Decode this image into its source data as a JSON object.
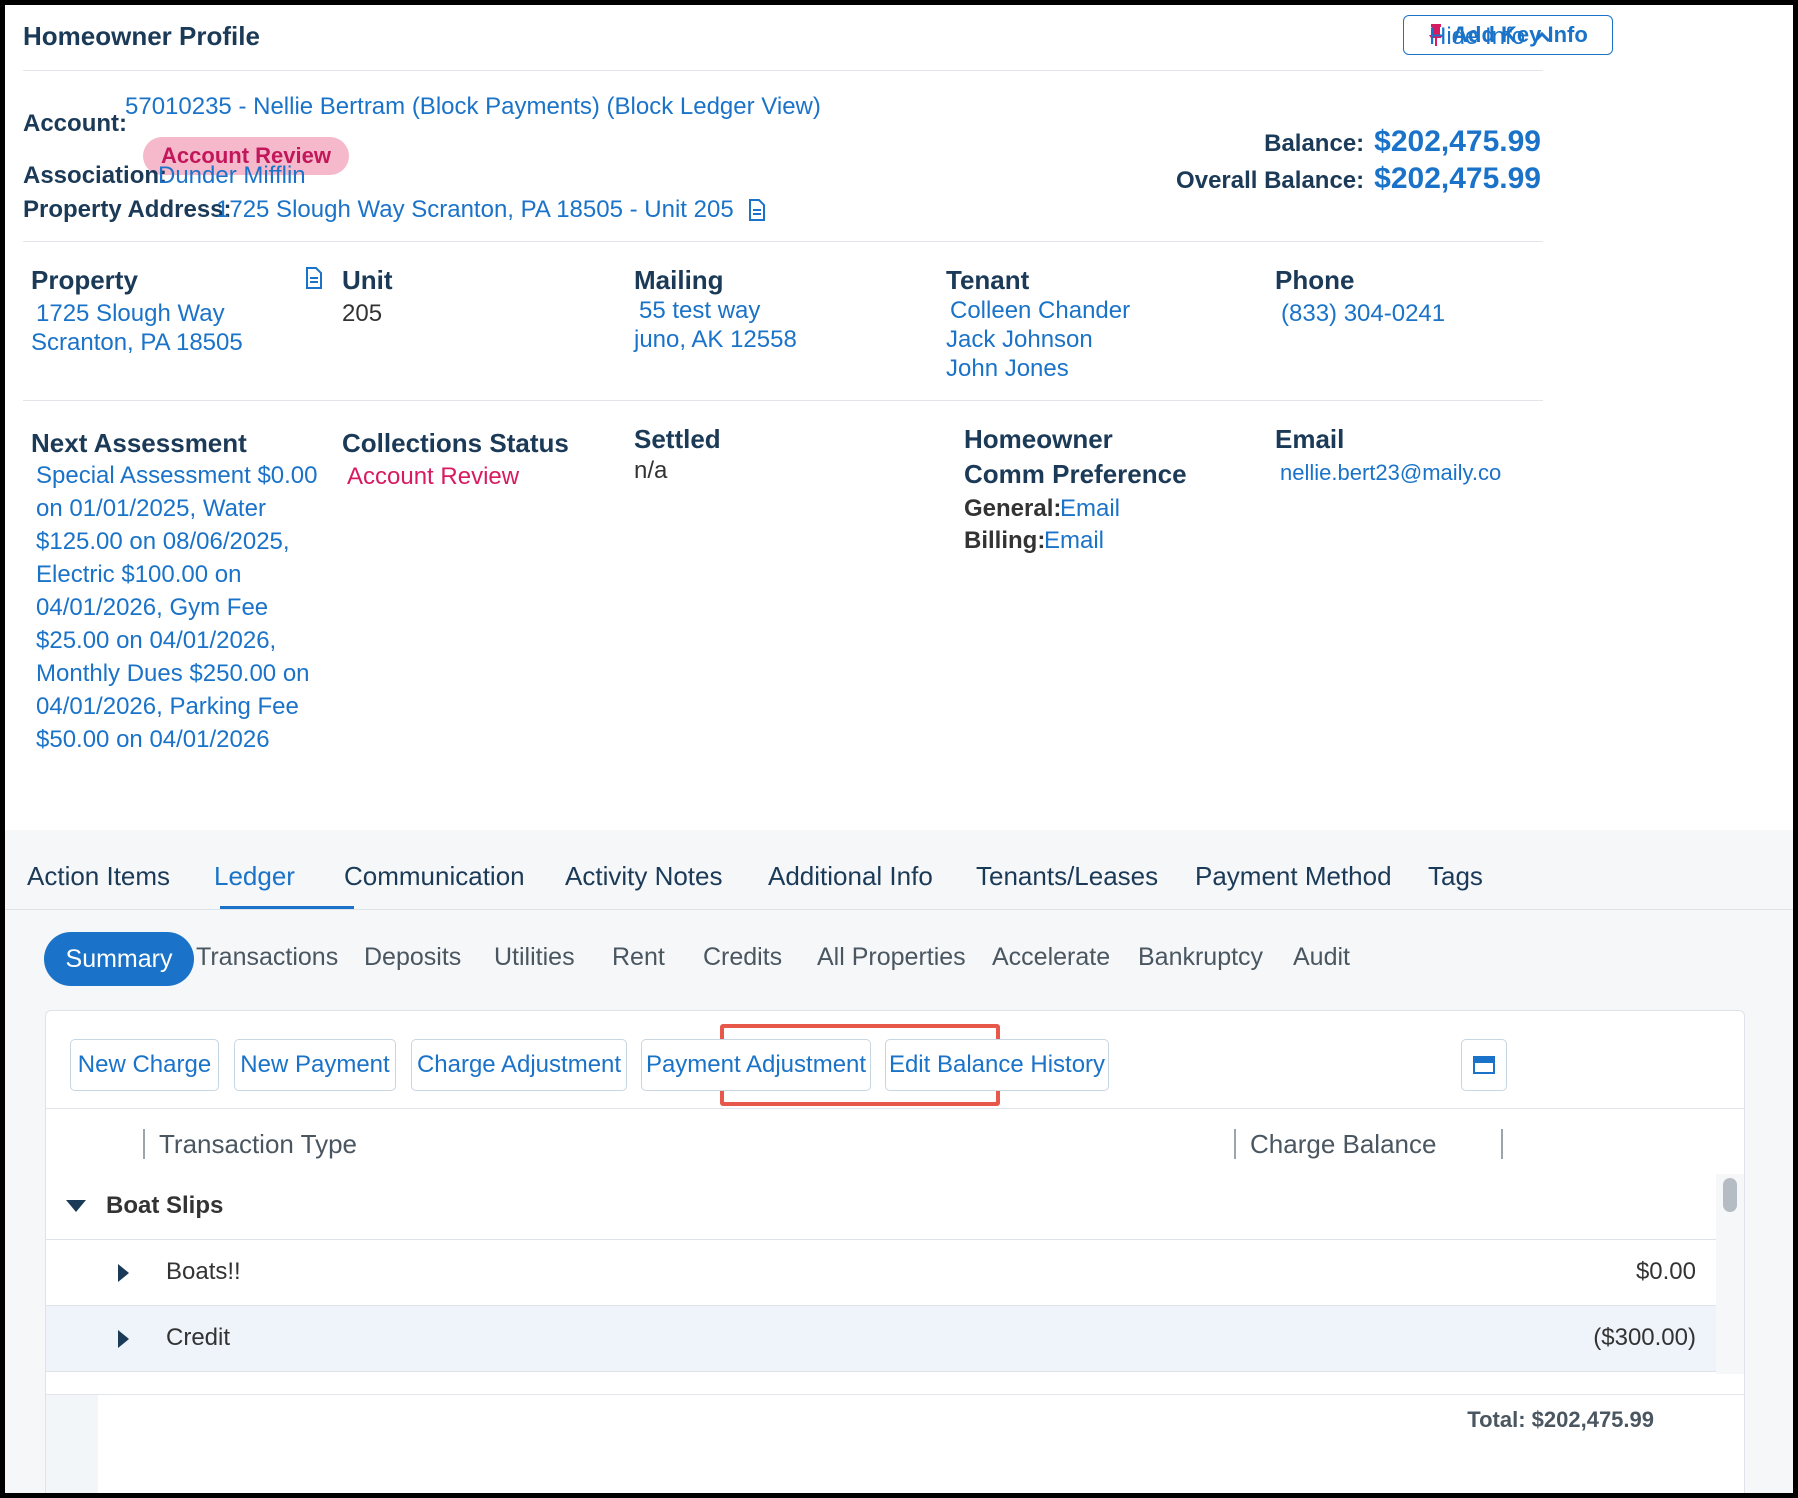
{
  "header": {
    "title": "Homeowner Profile",
    "add_key_info_label": "Add Key Info",
    "hide_info_label": "Hide Info"
  },
  "account": {
    "label": "Account:",
    "value": "57010235 - Nellie Bertram (Block Payments) (Block Ledger View)",
    "badge": "Account Review",
    "association_label": "Association:",
    "association_value": "Dunder Mifflin",
    "property_address_label": "Property Address:",
    "property_address_value": "1725 Slough Way Scranton, PA 18505 - Unit 205",
    "balance_label": "Balance:",
    "balance_value": "$202,475.99",
    "overall_balance_label": "Overall Balance:",
    "overall_balance_value": "$202,475.99"
  },
  "details": {
    "property": {
      "heading": "Property",
      "line1": "1725 Slough Way",
      "line2": "Scranton, PA 18505"
    },
    "unit": {
      "heading": "Unit",
      "value": "205"
    },
    "mailing": {
      "heading": "Mailing",
      "line1": "55 test way",
      "line2": "juno, AK 12558"
    },
    "tenant": {
      "heading": "Tenant",
      "names": [
        "Colleen Chander",
        "Jack Johnson",
        "John Jones"
      ]
    },
    "phone": {
      "heading": "Phone",
      "value": "(833) 304-0241"
    },
    "next_assessment": {
      "heading": "Next Assessment",
      "value": "Special Assessment $0.00 on 01/01/2025, Water $125.00 on 08/06/2025, Electric $100.00 on 04/01/2026, Gym Fee $25.00 on 04/01/2026, Monthly Dues $250.00 on 04/01/2026, Parking Fee $50.00 on 04/01/2026"
    },
    "collections_status": {
      "heading": "Collections Status",
      "value": "Account Review"
    },
    "settled": {
      "heading": "Settled",
      "value": "n/a"
    },
    "comm_preference": {
      "heading_line1": "Homeowner",
      "heading_line2": "Comm Preference",
      "general_label": "General:",
      "general_value": "Email",
      "billing_label": "Billing:",
      "billing_value": "Email"
    },
    "email": {
      "heading": "Email",
      "value": "nellie.bert23@maily.co"
    }
  },
  "tabs": [
    "Action Items",
    "Ledger",
    "Communication",
    "Activity Notes",
    "Additional Info",
    "Tenants/Leases",
    "Payment Method",
    "Tags"
  ],
  "active_tab": "Ledger",
  "subtabs": [
    "Summary",
    "Transactions",
    "Deposits",
    "Utilities",
    "Rent",
    "Credits",
    "All Properties",
    "Accelerate",
    "Bankruptcy",
    "Audit"
  ],
  "active_subtab": "Summary",
  "actions": {
    "new_charge": "New Charge",
    "new_payment": "New Payment",
    "charge_adjustment": "Charge Adjustment",
    "payment_adjustment": "Payment Adjustment",
    "edit_balance_history": "Edit Balance History"
  },
  "table": {
    "col_type": "Transaction Type",
    "col_balance": "Charge Balance",
    "group": "Boat Slips",
    "rows": [
      {
        "type": "Boats!!",
        "balance": "$0.00"
      },
      {
        "type": "Credit",
        "balance": "($300.00)"
      }
    ],
    "total": "Total: $202,475.99"
  },
  "colors": {
    "accent": "#1a73c8",
    "heading": "#1b3a57",
    "alert": "#d81b60",
    "highlight": "#e8584a"
  }
}
